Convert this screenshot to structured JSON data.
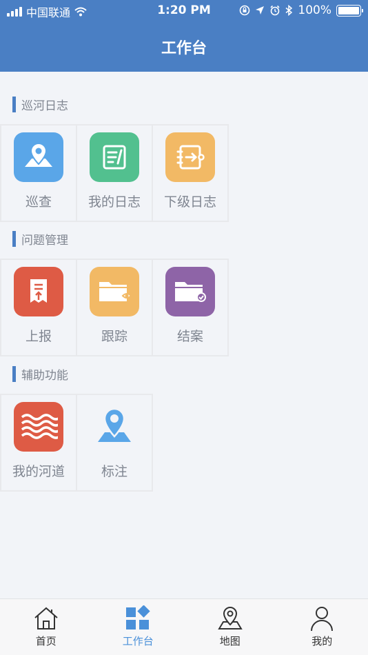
{
  "status_bar": {
    "carrier": "中国联通",
    "time": "1:20 PM",
    "battery": "100%"
  },
  "nav": {
    "title": "工作台"
  },
  "sections": [
    {
      "title": "巡河日志",
      "items": [
        {
          "label": "巡查",
          "icon": "map-pin-icon",
          "color": "#5aa6e8"
        },
        {
          "label": "我的日志",
          "icon": "notebook-pen-icon",
          "color": "#52c08f"
        },
        {
          "label": "下级日志",
          "icon": "log-forward-icon",
          "color": "#f2b965"
        }
      ]
    },
    {
      "title": "问题管理",
      "items": [
        {
          "label": "上报",
          "icon": "document-upload-icon",
          "color": "#de5b45"
        },
        {
          "label": "跟踪",
          "icon": "folder-eye-icon",
          "color": "#f2b965"
        },
        {
          "label": "结案",
          "icon": "folder-check-icon",
          "color": "#8e64a7"
        }
      ]
    },
    {
      "title": "辅助功能",
      "items": [
        {
          "label": "我的河道",
          "icon": "river-waves-icon",
          "color": "#de5b45"
        },
        {
          "label": "标注",
          "icon": "location-marker-icon",
          "color": "#5aa6e8"
        }
      ]
    }
  ],
  "tabs": [
    {
      "label": "首页",
      "icon": "home-icon",
      "active": false
    },
    {
      "label": "工作台",
      "icon": "workbench-icon",
      "active": true
    },
    {
      "label": "地图",
      "icon": "map-icon",
      "active": false
    },
    {
      "label": "我的",
      "icon": "user-icon",
      "active": false
    }
  ],
  "colors": {
    "primary": "#4a7fc4",
    "tab_active": "#4a90d9"
  }
}
